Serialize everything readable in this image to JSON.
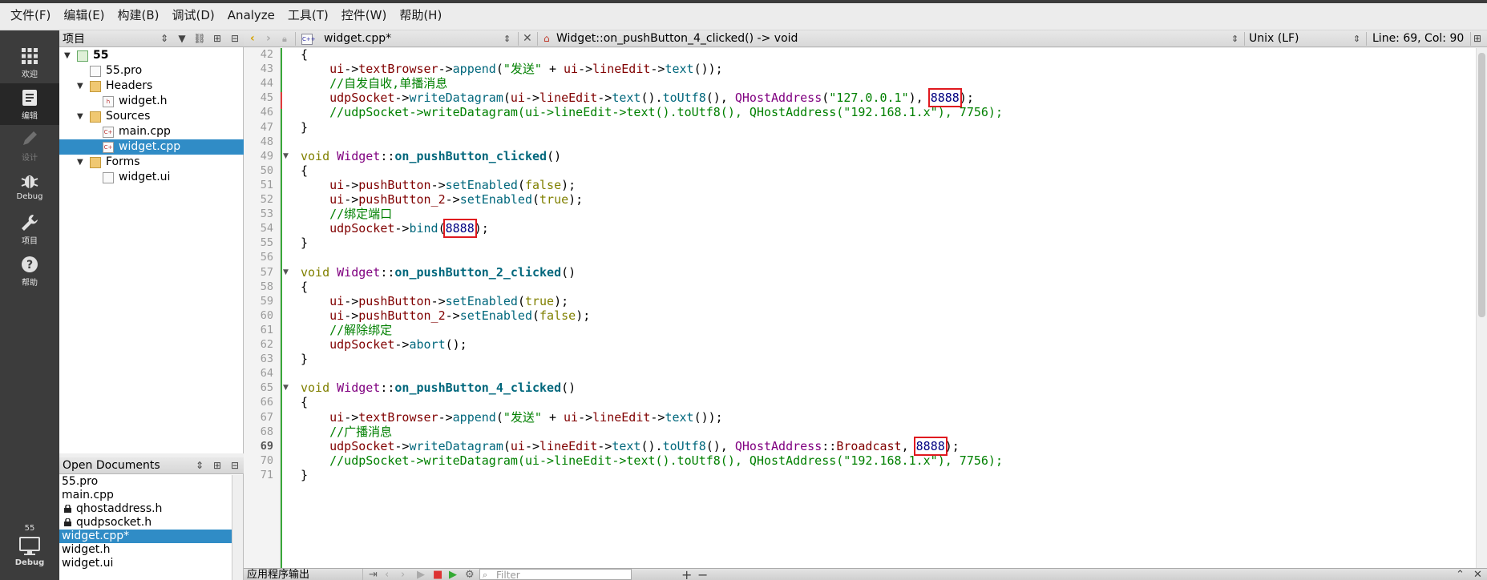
{
  "menu": [
    "文件(F)",
    "编辑(E)",
    "构建(B)",
    "调试(D)",
    "Analyze",
    "工具(T)",
    "控件(W)",
    "帮助(H)"
  ],
  "modes": [
    {
      "label": "欢迎",
      "icon": "grid-icon"
    },
    {
      "label": "编辑",
      "icon": "edit-icon"
    },
    {
      "label": "设计",
      "icon": "pencil-icon"
    },
    {
      "label": "Debug",
      "icon": "bug-icon"
    },
    {
      "label": "项目",
      "icon": "wrench-icon"
    },
    {
      "label": "帮助",
      "icon": "help-icon"
    }
  ],
  "kit": {
    "name": "55",
    "label": "Debug"
  },
  "project_pane": {
    "title": "项目",
    "tree": [
      {
        "label": "55",
        "level": 0,
        "expanded": true,
        "type": "project"
      },
      {
        "label": "55.pro",
        "level": 1,
        "type": "file"
      },
      {
        "label": "Headers",
        "level": 1,
        "expanded": true,
        "type": "folder"
      },
      {
        "label": "widget.h",
        "level": 2,
        "type": "header"
      },
      {
        "label": "Sources",
        "level": 1,
        "expanded": true,
        "type": "folder"
      },
      {
        "label": "main.cpp",
        "level": 2,
        "type": "source"
      },
      {
        "label": "widget.cpp",
        "level": 2,
        "type": "source",
        "selected": true
      },
      {
        "label": "Forms",
        "level": 1,
        "expanded": true,
        "type": "folder"
      },
      {
        "label": "widget.ui",
        "level": 2,
        "type": "form"
      }
    ]
  },
  "open_documents": {
    "title": "Open Documents",
    "items": [
      {
        "label": "55.pro",
        "locked": false
      },
      {
        "label": "main.cpp",
        "locked": false
      },
      {
        "label": "qhostaddress.h",
        "locked": true
      },
      {
        "label": "qudpsocket.h",
        "locked": true
      },
      {
        "label": "widget.cpp*",
        "locked": false,
        "selected": true
      },
      {
        "label": "widget.h",
        "locked": false
      },
      {
        "label": "widget.ui",
        "locked": false
      }
    ]
  },
  "editor_toolbar": {
    "file": "widget.cpp*",
    "symbol": "Widget::on_pushButton_4_clicked() -> void",
    "line_ending": "Unix (LF)",
    "position": "Line: 69, Col: 90"
  },
  "editor": {
    "current_line": 69,
    "lines": [
      {
        "n": 42,
        "fold": false,
        "segs": [
          [
            "p",
            "{"
          ]
        ]
      },
      {
        "n": 43,
        "segs": [
          [
            "p",
            "    "
          ],
          [
            "var",
            "ui"
          ],
          [
            "p",
            "->"
          ],
          [
            "var",
            "textBrowser"
          ],
          [
            "p",
            "->"
          ],
          [
            "fn",
            "append"
          ],
          [
            "p",
            "("
          ],
          [
            "str",
            "\"发送\""
          ],
          [
            "p",
            " + "
          ],
          [
            "var",
            "ui"
          ],
          [
            "p",
            "->"
          ],
          [
            "var",
            "lineEdit"
          ],
          [
            "p",
            "->"
          ],
          [
            "fn",
            "text"
          ],
          [
            "p",
            "());"
          ]
        ]
      },
      {
        "n": 44,
        "segs": [
          [
            "p",
            "    "
          ],
          [
            "cmt",
            "//自发自收,单播消息"
          ]
        ]
      },
      {
        "n": 45,
        "segs": [
          [
            "p",
            "    "
          ],
          [
            "var",
            "udpSocket"
          ],
          [
            "p",
            "->"
          ],
          [
            "fn",
            "writeDatagram"
          ],
          [
            "p",
            "("
          ],
          [
            "var",
            "ui"
          ],
          [
            "p",
            "->"
          ],
          [
            "var",
            "lineEdit"
          ],
          [
            "p",
            "->"
          ],
          [
            "fn",
            "text"
          ],
          [
            "p",
            "()."
          ],
          [
            "fn",
            "toUtf8"
          ],
          [
            "p",
            "(), "
          ],
          [
            "cls",
            "QHostAddress"
          ],
          [
            "p",
            "("
          ],
          [
            "str",
            "\"127.0.0.1\""
          ],
          [
            "p",
            "), "
          ],
          [
            "numhl",
            "8888"
          ],
          [
            "p",
            ");"
          ]
        ]
      },
      {
        "n": 46,
        "segs": [
          [
            "p",
            "    "
          ],
          [
            "cmt",
            "//udpSocket->writeDatagram(ui->lineEdit->text().toUtf8(), QHostAddress(\"192.168.1.x\"), 7756);"
          ]
        ]
      },
      {
        "n": 47,
        "segs": [
          [
            "p",
            "}"
          ]
        ]
      },
      {
        "n": 48,
        "segs": []
      },
      {
        "n": 49,
        "fold": true,
        "segs": [
          [
            "kw",
            "void"
          ],
          [
            "p",
            " "
          ],
          [
            "cls",
            "Widget"
          ],
          [
            "p",
            "::"
          ],
          [
            "fnb",
            "on_pushButton_clicked"
          ],
          [
            "p",
            "()"
          ]
        ]
      },
      {
        "n": 50,
        "segs": [
          [
            "p",
            "{"
          ]
        ]
      },
      {
        "n": 51,
        "segs": [
          [
            "p",
            "    "
          ],
          [
            "var",
            "ui"
          ],
          [
            "p",
            "->"
          ],
          [
            "var",
            "pushButton"
          ],
          [
            "p",
            "->"
          ],
          [
            "fn",
            "setEnabled"
          ],
          [
            "p",
            "("
          ],
          [
            "bool",
            "false"
          ],
          [
            "p",
            ");"
          ]
        ]
      },
      {
        "n": 52,
        "segs": [
          [
            "p",
            "    "
          ],
          [
            "var",
            "ui"
          ],
          [
            "p",
            "->"
          ],
          [
            "var",
            "pushButton_2"
          ],
          [
            "p",
            "->"
          ],
          [
            "fn",
            "setEnabled"
          ],
          [
            "p",
            "("
          ],
          [
            "bool",
            "true"
          ],
          [
            "p",
            ");"
          ]
        ]
      },
      {
        "n": 53,
        "segs": [
          [
            "p",
            "    "
          ],
          [
            "cmt",
            "//绑定端口"
          ]
        ]
      },
      {
        "n": 54,
        "segs": [
          [
            "p",
            "    "
          ],
          [
            "var",
            "udpSocket"
          ],
          [
            "p",
            "->"
          ],
          [
            "fn",
            "bind"
          ],
          [
            "p",
            "("
          ],
          [
            "numhl",
            "8888"
          ],
          [
            "p",
            ");"
          ]
        ]
      },
      {
        "n": 55,
        "segs": [
          [
            "p",
            "}"
          ]
        ]
      },
      {
        "n": 56,
        "segs": []
      },
      {
        "n": 57,
        "fold": true,
        "segs": [
          [
            "kw",
            "void"
          ],
          [
            "p",
            " "
          ],
          [
            "cls",
            "Widget"
          ],
          [
            "p",
            "::"
          ],
          [
            "fnb",
            "on_pushButton_2_clicked"
          ],
          [
            "p",
            "()"
          ]
        ]
      },
      {
        "n": 58,
        "segs": [
          [
            "p",
            "{"
          ]
        ]
      },
      {
        "n": 59,
        "segs": [
          [
            "p",
            "    "
          ],
          [
            "var",
            "ui"
          ],
          [
            "p",
            "->"
          ],
          [
            "var",
            "pushButton"
          ],
          [
            "p",
            "->"
          ],
          [
            "fn",
            "setEnabled"
          ],
          [
            "p",
            "("
          ],
          [
            "bool",
            "true"
          ],
          [
            "p",
            ");"
          ]
        ]
      },
      {
        "n": 60,
        "segs": [
          [
            "p",
            "    "
          ],
          [
            "var",
            "ui"
          ],
          [
            "p",
            "->"
          ],
          [
            "var",
            "pushButton_2"
          ],
          [
            "p",
            "->"
          ],
          [
            "fn",
            "setEnabled"
          ],
          [
            "p",
            "("
          ],
          [
            "bool",
            "false"
          ],
          [
            "p",
            ");"
          ]
        ]
      },
      {
        "n": 61,
        "segs": [
          [
            "p",
            "    "
          ],
          [
            "cmt",
            "//解除绑定"
          ]
        ]
      },
      {
        "n": 62,
        "segs": [
          [
            "p",
            "    "
          ],
          [
            "var",
            "udpSocket"
          ],
          [
            "p",
            "->"
          ],
          [
            "fn",
            "abort"
          ],
          [
            "p",
            "();"
          ]
        ]
      },
      {
        "n": 63,
        "segs": [
          [
            "p",
            "}"
          ]
        ]
      },
      {
        "n": 64,
        "segs": []
      },
      {
        "n": 65,
        "fold": true,
        "segs": [
          [
            "kw",
            "void"
          ],
          [
            "p",
            " "
          ],
          [
            "cls",
            "Widget"
          ],
          [
            "p",
            "::"
          ],
          [
            "fnb",
            "on_pushButton_4_clicked"
          ],
          [
            "p",
            "()"
          ]
        ]
      },
      {
        "n": 66,
        "segs": [
          [
            "p",
            "{"
          ]
        ]
      },
      {
        "n": 67,
        "segs": [
          [
            "p",
            "    "
          ],
          [
            "var",
            "ui"
          ],
          [
            "p",
            "->"
          ],
          [
            "var",
            "textBrowser"
          ],
          [
            "p",
            "->"
          ],
          [
            "fn",
            "append"
          ],
          [
            "p",
            "("
          ],
          [
            "str",
            "\"发送\""
          ],
          [
            "p",
            " + "
          ],
          [
            "var",
            "ui"
          ],
          [
            "p",
            "->"
          ],
          [
            "var",
            "lineEdit"
          ],
          [
            "p",
            "->"
          ],
          [
            "fn",
            "text"
          ],
          [
            "p",
            "());"
          ]
        ]
      },
      {
        "n": 68,
        "segs": [
          [
            "p",
            "    "
          ],
          [
            "cmt",
            "//广播消息"
          ]
        ]
      },
      {
        "n": 69,
        "segs": [
          [
            "p",
            "    "
          ],
          [
            "var",
            "udpSocket"
          ],
          [
            "p",
            "->"
          ],
          [
            "fn",
            "writeDatagram"
          ],
          [
            "p",
            "("
          ],
          [
            "var",
            "ui"
          ],
          [
            "p",
            "->"
          ],
          [
            "var",
            "lineEdit"
          ],
          [
            "p",
            "->"
          ],
          [
            "fn",
            "text"
          ],
          [
            "p",
            "()."
          ],
          [
            "fn",
            "toUtf8"
          ],
          [
            "p",
            "(), "
          ],
          [
            "cls",
            "QHostAddress"
          ],
          [
            "p",
            "::"
          ],
          [
            "var",
            "Broadcast"
          ],
          [
            "p",
            ", "
          ],
          [
            "numhl",
            "8888"
          ],
          [
            "p",
            ");"
          ]
        ]
      },
      {
        "n": 70,
        "segs": [
          [
            "p",
            "    "
          ],
          [
            "cmt",
            "//udpSocket->writeDatagram(ui->lineEdit->text().toUtf8(), QHostAddress(\"192.168.1.x\"), 7756);"
          ]
        ]
      },
      {
        "n": 71,
        "segs": [
          [
            "p",
            "}"
          ]
        ]
      }
    ]
  },
  "output_bar": {
    "title": "应用程序输出",
    "filter_placeholder": "Filter"
  },
  "colors": {
    "selection": "#308cc6",
    "mode_bar": "#3c3c3c",
    "highlight_box": "#e0191f"
  }
}
